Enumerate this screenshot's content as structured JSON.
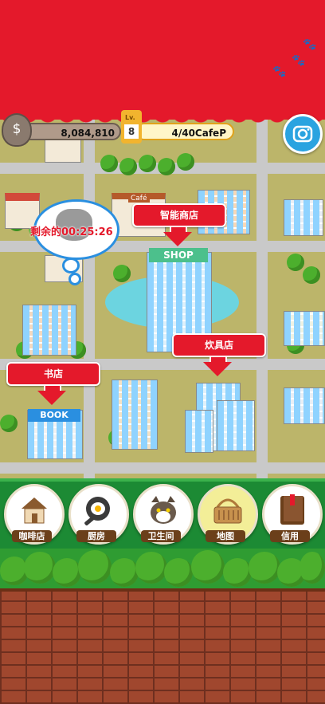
{
  "hud": {
    "money": "8,084,810",
    "level": "8",
    "level_prefix": "Lv.",
    "cafe_points": "4/40CafeP",
    "money_icon": "dollar-bag-icon",
    "camera_icon": "camera-icon"
  },
  "map": {
    "timer_text": "剩余的00:25:26",
    "labels": {
      "smart_shop": "智能商店",
      "kitchenware": "炊具店",
      "bookstore": "书店"
    },
    "signs": {
      "shop": "SHOP",
      "book": "BOOK",
      "cafe": "Café"
    }
  },
  "nav": [
    {
      "label": "咖啡店",
      "icon": "cafe-house-icon"
    },
    {
      "label": "厨房",
      "icon": "frying-pan-icon"
    },
    {
      "label": "卫生间",
      "icon": "cat-face-icon"
    },
    {
      "label": "地图",
      "icon": "basket-icon",
      "active": true
    },
    {
      "label": "信用",
      "icon": "book-icon"
    }
  ],
  "colors": {
    "brand_red": "#e4192b",
    "nav_green": "#1c8a34",
    "accent_blue": "#2aa3e0"
  }
}
